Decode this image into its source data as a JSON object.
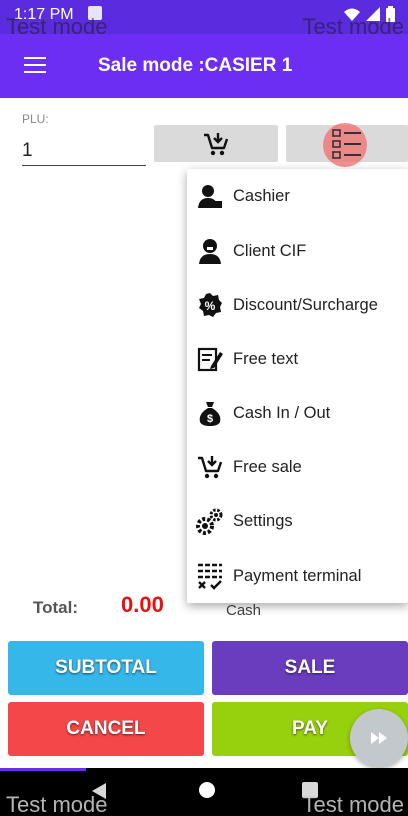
{
  "status_bar": {
    "time": "1:17 PM",
    "icons": "wifi-icon signal-icon battery-icon",
    "watermark": "Test mode"
  },
  "app_bar": {
    "title": "Sale mode :CASIER 1"
  },
  "plu": {
    "label": "PLU:",
    "value": "1"
  },
  "toolbar": {
    "buttons": [
      "add-to-cart-icon",
      "menu-list-icon"
    ]
  },
  "popup_menu": {
    "items": [
      {
        "label": "Cashier",
        "icon": "user-icon"
      },
      {
        "label": "Client CIF",
        "icon": "client-icon"
      },
      {
        "label": "Discount/Surcharge",
        "icon": "percent-icon"
      },
      {
        "label": "Free text",
        "icon": "edit-icon"
      },
      {
        "label": "Cash In / Out",
        "icon": "money-bag-icon"
      },
      {
        "label": "Free sale",
        "icon": "cart-add-icon"
      },
      {
        "label": "Settings",
        "icon": "gears-icon"
      },
      {
        "label": "Payment terminal",
        "icon": "payment-terminal-icon"
      }
    ]
  },
  "totals": {
    "label": "Total:",
    "value": "0.00",
    "partial_text": "Cash"
  },
  "actions": {
    "subtotal": "SUBTOTAL",
    "sale": "SALE",
    "cancel": "CANCEL",
    "pay": "PAY"
  },
  "colors": {
    "primary": "#6b2ef2",
    "subtotal": "#35b7ea",
    "sale": "#6a3dbf",
    "cancel": "#f4474a",
    "pay": "#97d00c",
    "total_value": "#e81010"
  },
  "watermark": "Test mode"
}
